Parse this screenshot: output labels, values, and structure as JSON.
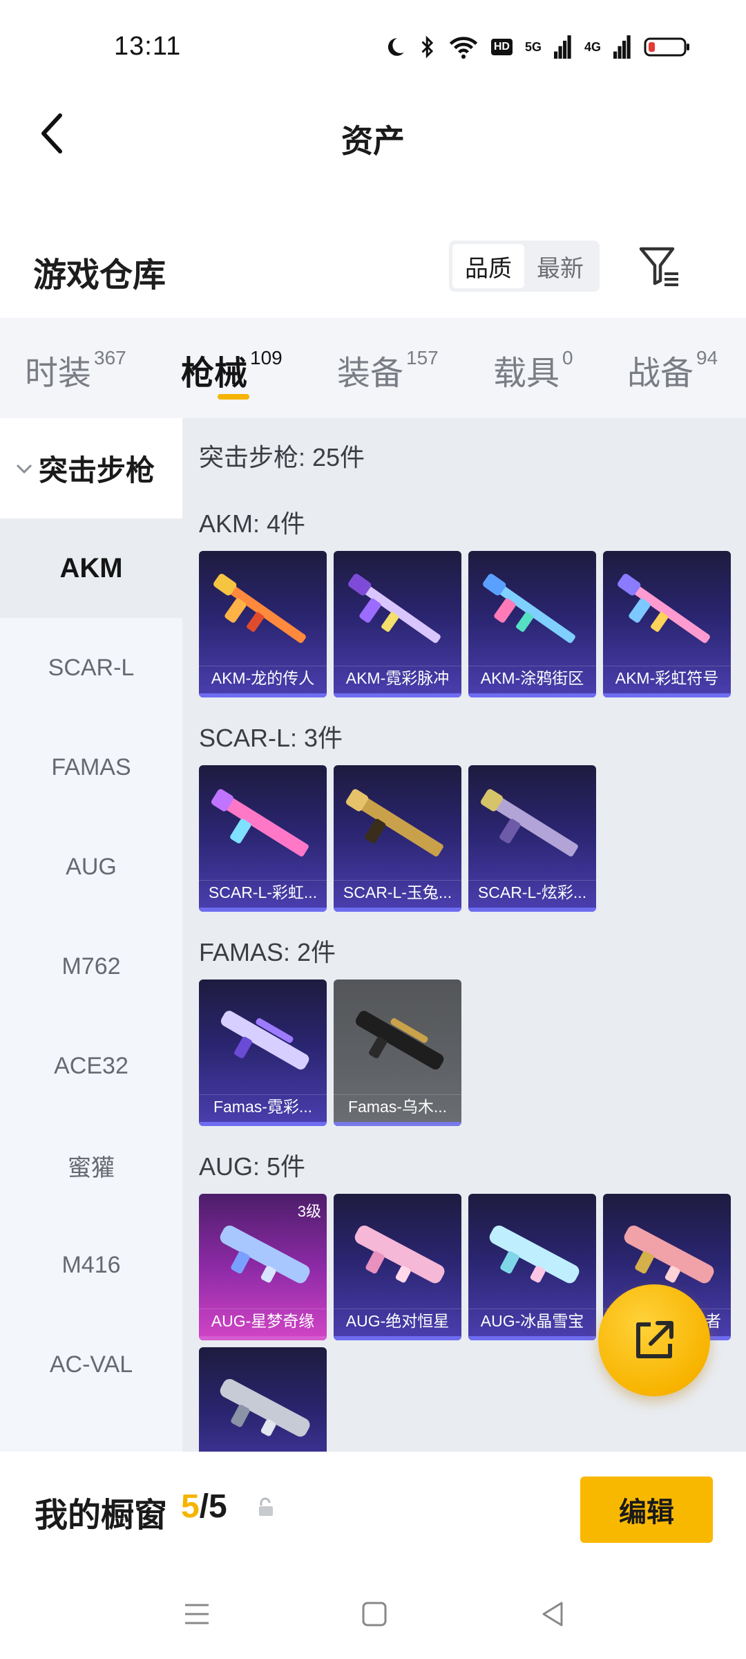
{
  "status_bar": {
    "time": "13:11",
    "net1": "5G",
    "net2": "4G",
    "hd": "HD"
  },
  "header": {
    "title": "资产"
  },
  "warehouse": {
    "title": "游戏仓库",
    "sort_options": [
      "品质",
      "最新"
    ]
  },
  "tabs": [
    {
      "label": "时装",
      "count": "367"
    },
    {
      "label": "枪械",
      "count": "109"
    },
    {
      "label": "装备",
      "count": "157"
    },
    {
      "label": "载具",
      "count": "0"
    },
    {
      "label": "战备",
      "count": "94"
    }
  ],
  "sidebar": {
    "group": "突击步枪",
    "items": [
      "AKM",
      "SCAR-L",
      "FAMAS",
      "AUG",
      "M762",
      "ACE32",
      "蜜獾",
      "M416",
      "AC-VAL"
    ]
  },
  "content": {
    "summary": "突击步枪: 25件",
    "sections": [
      {
        "title": "AKM: 4件",
        "items": [
          "AKM-龙的传人",
          "AKM-霓彩脉冲",
          "AKM-涂鸦街区",
          "AKM-彩虹符号"
        ]
      },
      {
        "title": "SCAR-L: 3件",
        "items": [
          "SCAR-L-彩虹...",
          "SCAR-L-玉兔...",
          "SCAR-L-炫彩..."
        ]
      },
      {
        "title": "FAMAS: 2件",
        "items": [
          "Famas-霓彩...",
          "Famas-乌木..."
        ]
      },
      {
        "title": "AUG: 5件",
        "items": [
          "AUG-星梦奇缘",
          "AUG-绝对恒星",
          "AUG-冰晶雪宝",
          "者",
          ""
        ],
        "level_badge": "3级"
      }
    ]
  },
  "showcase": {
    "label": "我的橱窗",
    "current": "5",
    "total": "/5",
    "edit": "编辑"
  },
  "colors": {
    "accent": "#f5b400",
    "card_purple": "#2a2570"
  }
}
